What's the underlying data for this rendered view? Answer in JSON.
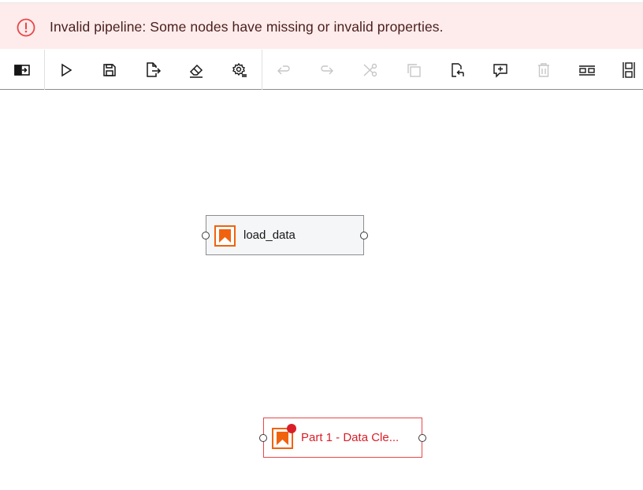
{
  "banner": {
    "icon": "warning-circle-icon",
    "message": "Invalid pipeline: Some nodes have missing or invalid properties.",
    "color": "#da1e28"
  },
  "toolbar": {
    "buttons": [
      {
        "name": "toggle-palette",
        "icon": "panel-open-icon",
        "enabled": true
      },
      {
        "name": "run-pipeline",
        "icon": "play-icon",
        "enabled": true
      },
      {
        "name": "save-pipeline",
        "icon": "save-icon",
        "enabled": true
      },
      {
        "name": "export-pipeline",
        "icon": "export-icon",
        "enabled": true
      },
      {
        "name": "clear-pipeline",
        "icon": "eraser-icon",
        "enabled": true
      },
      {
        "name": "runtime-settings",
        "icon": "settings-icon",
        "enabled": true
      },
      {
        "name": "undo",
        "icon": "undo-icon",
        "enabled": false
      },
      {
        "name": "redo",
        "icon": "redo-icon",
        "enabled": false
      },
      {
        "name": "cut",
        "icon": "cut-icon",
        "enabled": false
      },
      {
        "name": "copy",
        "icon": "copy-icon",
        "enabled": false
      },
      {
        "name": "paste",
        "icon": "paste-icon",
        "enabled": true
      },
      {
        "name": "add-comment",
        "icon": "comment-add-icon",
        "enabled": true
      },
      {
        "name": "delete",
        "icon": "trash-icon",
        "enabled": false
      },
      {
        "name": "arrange-horizontal",
        "icon": "arrange-horizontal-icon",
        "enabled": true
      },
      {
        "name": "arrange-vertical",
        "icon": "arrange-vertical-icon",
        "enabled": true
      }
    ]
  },
  "nodes": [
    {
      "label": "load_data",
      "icon": "notebook-icon",
      "error": false
    },
    {
      "label": "Part 1 - Data Cle...",
      "icon": "notebook-icon",
      "error": true
    }
  ],
  "colors": {
    "node_icon": "#f1620e",
    "error": "#da1e28"
  }
}
